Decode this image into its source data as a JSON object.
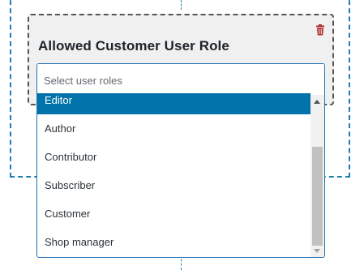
{
  "card": {
    "title": "Allowed Customer User Role"
  },
  "select": {
    "placeholder": "Select user roles",
    "highlighted_option": "Editor",
    "options": [
      "Editor",
      "Author",
      "Contributor",
      "Subscriber",
      "Customer",
      "Shop manager"
    ]
  },
  "colors": {
    "accent": "#2271b1",
    "highlight": "#0073aa",
    "delete": "#b32d2e",
    "frame": "#1a7fb3"
  },
  "icons": {
    "delete": "trash-icon"
  }
}
